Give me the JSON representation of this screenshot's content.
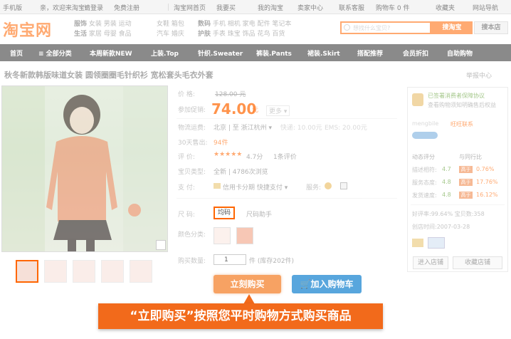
{
  "topbar": {
    "mobile": "手机版",
    "greeting": "亲，欢迎来淘宝!",
    "login": "请登录",
    "register": "免费注册",
    "home": "淘宝网首页",
    "buy": "我要买",
    "my_taobao": "我的淘宝",
    "seller": "卖家中心",
    "service": "联系客服",
    "cart": "购物车 0 件",
    "favorites": "收藏夹",
    "sitenav": "网站导航"
  },
  "header": {
    "logo": "淘宝网",
    "cat_groups": [
      {
        "title1": "服饰",
        "title2": "生活",
        "row1": "女装  男装  运动",
        "row2": "家居  母婴  食品"
      },
      {
        "row1": "女鞋  箱包",
        "row2": "汽车  婚庆"
      },
      {
        "title1": "数码",
        "title2": "护肤",
        "row1": "手机  相机  家电  配件  笔记本",
        "row2": "手表  珠宝  饰品  花鸟  百货"
      }
    ],
    "search_placeholder": "想找什么宝贝?",
    "search_button": "搜淘宝",
    "search_store": "搜本店"
  },
  "nav": [
    "首页",
    "≡ 全部分类",
    "本周新款NEW",
    "上装.Top",
    "针织.Sweater",
    "裤装.Pants",
    "裙装.Skirt",
    "搭配推荐",
    "会员折扣",
    "自助购物"
  ],
  "product": {
    "title": "秋冬新款韩版味道女装 圆领圈圈毛针织衫 宽松套头毛衣外套",
    "report": "举报中心",
    "price_label": "价  格:",
    "orig_price": "128.00 元",
    "promo_label": "参加促销:",
    "promo_price": "74.00",
    "promo_unit": "元",
    "promo_more": "更多 ▾",
    "shipping_label": "物流运费:",
    "shipping_value": "北京 | 至  浙江杭州 ▾",
    "shipping_fee1": "快递: 10.00元",
    "shipping_fee2": "EMS: 20.00元",
    "sold_label": "30天售出:",
    "sold_value": "94件",
    "rating_label": "评  价:",
    "rating_stars": "★★★★★",
    "rating_score": "4.7分",
    "rating_count": "1条评价",
    "type_label": "宝贝类型:",
    "type_value": "全新  |  4786次浏览",
    "pay_label": "支  付:",
    "pay_value": "信用卡分期  快捷支付 ▾",
    "service_label": "服务:",
    "size_label": "尺  码:",
    "size_value": "均码",
    "size_helper": "尺码助手",
    "color_label": "颜色分类:",
    "qty_label": "购买数量:",
    "qty_value": "1",
    "stock": "件 (库存202件)",
    "buy_now": "立刻购买",
    "add_cart": "加入购物车"
  },
  "callout": "“立即购买”按照您平时购物方式购买商品",
  "panel": {
    "guarantee": "已签署消费者保障协议",
    "guarantee_sub": "查看购物须知明确售后权益",
    "seller_name": "mengbile",
    "seller_tag": "旺旺联系",
    "dsr_title": "动态评分",
    "compare_title": "与同行比",
    "rows": [
      {
        "label": "描述相符:",
        "score": "4.7",
        "badge": "高于",
        "pct": "0.76%"
      },
      {
        "label": "服务态度:",
        "score": "4.8",
        "badge": "高于",
        "pct": "17.76%"
      },
      {
        "label": "发货速度:",
        "score": "4.8",
        "badge": "高于",
        "pct": "16.12%"
      }
    ],
    "good_rate": "好评率:99.64%  宝贝数:358",
    "created": "创店时间:2007-03-28",
    "enter_store": "进入店铺",
    "fav_store": "收藏店铺"
  }
}
